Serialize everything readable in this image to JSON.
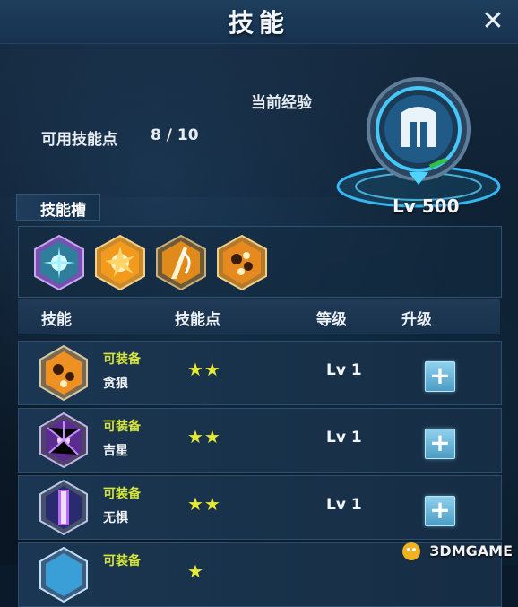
{
  "header": {
    "title": "技能",
    "close_symbol": "✕"
  },
  "stats": {
    "exp_label": "当前经验",
    "skill_points_label": "可用技能点",
    "skill_points_value": "8 / 10",
    "level": "Lv 500",
    "exp_progress_visible": true
  },
  "slot_section": {
    "label": "技能槽"
  },
  "slots": [
    {
      "icon": "star-burst-icon"
    },
    {
      "icon": "explosion-icon"
    },
    {
      "icon": "slash-icon"
    },
    {
      "icon": "blast-icon"
    }
  ],
  "table": {
    "headers": {
      "skill": "技能",
      "points": "技能点",
      "level": "等级",
      "upgrade": "升级"
    },
    "rows": [
      {
        "status": "可装备",
        "name": "贪狼",
        "stars": "★★",
        "level": "Lv 1",
        "upgrade": "+"
      },
      {
        "status": "可装备",
        "name": "吉星",
        "stars": "★★",
        "level": "Lv 1",
        "upgrade": "+"
      },
      {
        "status": "可装备",
        "name": "无惧",
        "stars": "★★",
        "level": "Lv 1",
        "upgrade": "+"
      },
      {
        "status": "可装备",
        "name": "",
        "stars": "★",
        "level": "",
        "upgrade": ""
      }
    ]
  },
  "watermark": "3DMGAME",
  "colors": {
    "accent": "#4fd3ff",
    "status": "#d5e53a",
    "star": "#e7ea32"
  }
}
